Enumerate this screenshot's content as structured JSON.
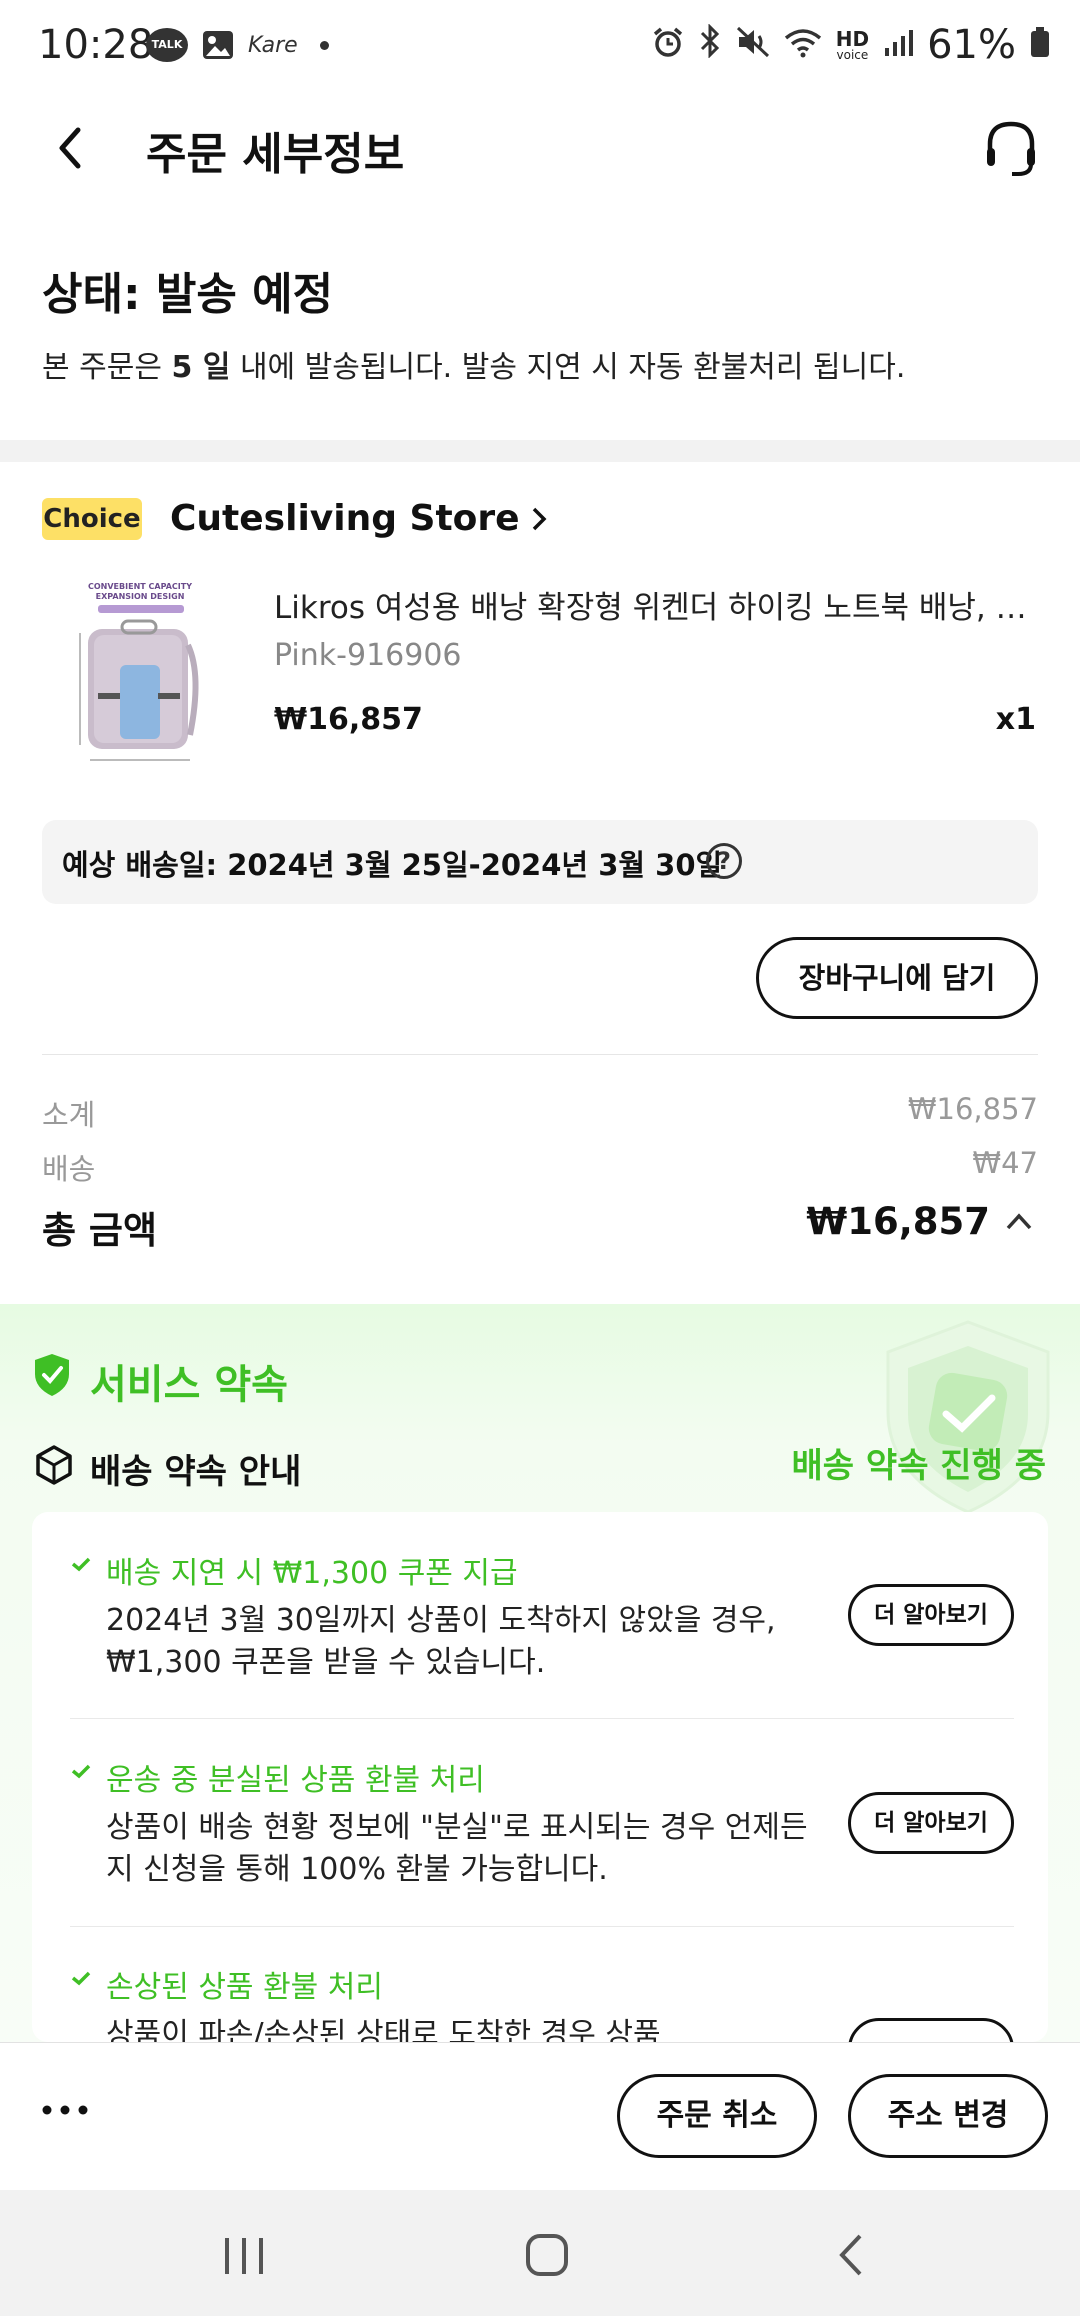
{
  "status_bar": {
    "time": "10:28",
    "notif_talk": "TALK",
    "notif_app": "Kare",
    "hd_label": "HD",
    "voice_label": "voice",
    "battery": "61%"
  },
  "header": {
    "title": "주문 세부정보"
  },
  "order_status": {
    "title": "상태: 발송 예정",
    "desc_prefix": "본 주문은 ",
    "desc_days": "5 일",
    "desc_suffix": " 내에 발송됩니다. 발송 지연 시 자동 환불처리 됩니다."
  },
  "store": {
    "badge": "Choice",
    "name": "Cutesliving Store"
  },
  "product": {
    "image_caption": "CONVEBIENT CAPACITY EXPANSION DESIGN",
    "title": "Likros 여성용 배낭 확장형 위켄더 하이킹 노트북 배낭, US...",
    "variant": "Pink-916906",
    "price": "₩16,857",
    "qty": "x1"
  },
  "delivery": {
    "expected": "예상 배송일: 2024년 3월 25일-2024년 3월 30일",
    "help": "?"
  },
  "cart_button": "장바구니에 담기",
  "summary": {
    "subtotal_label": "소계",
    "subtotal_value": "₩16,857",
    "shipping_label": "배송",
    "shipping_value": "₩47",
    "total_label": "총 금액",
    "total_value": "₩16,857"
  },
  "service": {
    "title": "서비스 약속",
    "promise_title": "배송 약속 안내",
    "promise_status": "배송 약속 진행 중",
    "items": [
      {
        "title": "배송 지연 시 ₩1,300 쿠폰 지급",
        "desc": "2024년 3월 30일까지 상품이 도착하지 않았을 경우, ₩1,300 쿠폰을 받을 수 있습니다.",
        "button": "더 알아보기"
      },
      {
        "title": "운송 중 분실된 상품 환불 처리",
        "desc": "상품이 배송 현황 정보에 \"분실\"로 표시되는 경우 언제든지 신청을 통해 100% 환불 가능합니다.",
        "button": "더 알아보기"
      },
      {
        "title": "손상된 상품 환불 처리",
        "desc": "상품이 파손/손상된 상태로 도착한 경우 상품"
      }
    ]
  },
  "actions": {
    "cancel": "주문 취소",
    "change_address": "주소 변경"
  },
  "colors": {
    "accent_green": "#3fbf25",
    "choice_yellow": "#fde066"
  }
}
